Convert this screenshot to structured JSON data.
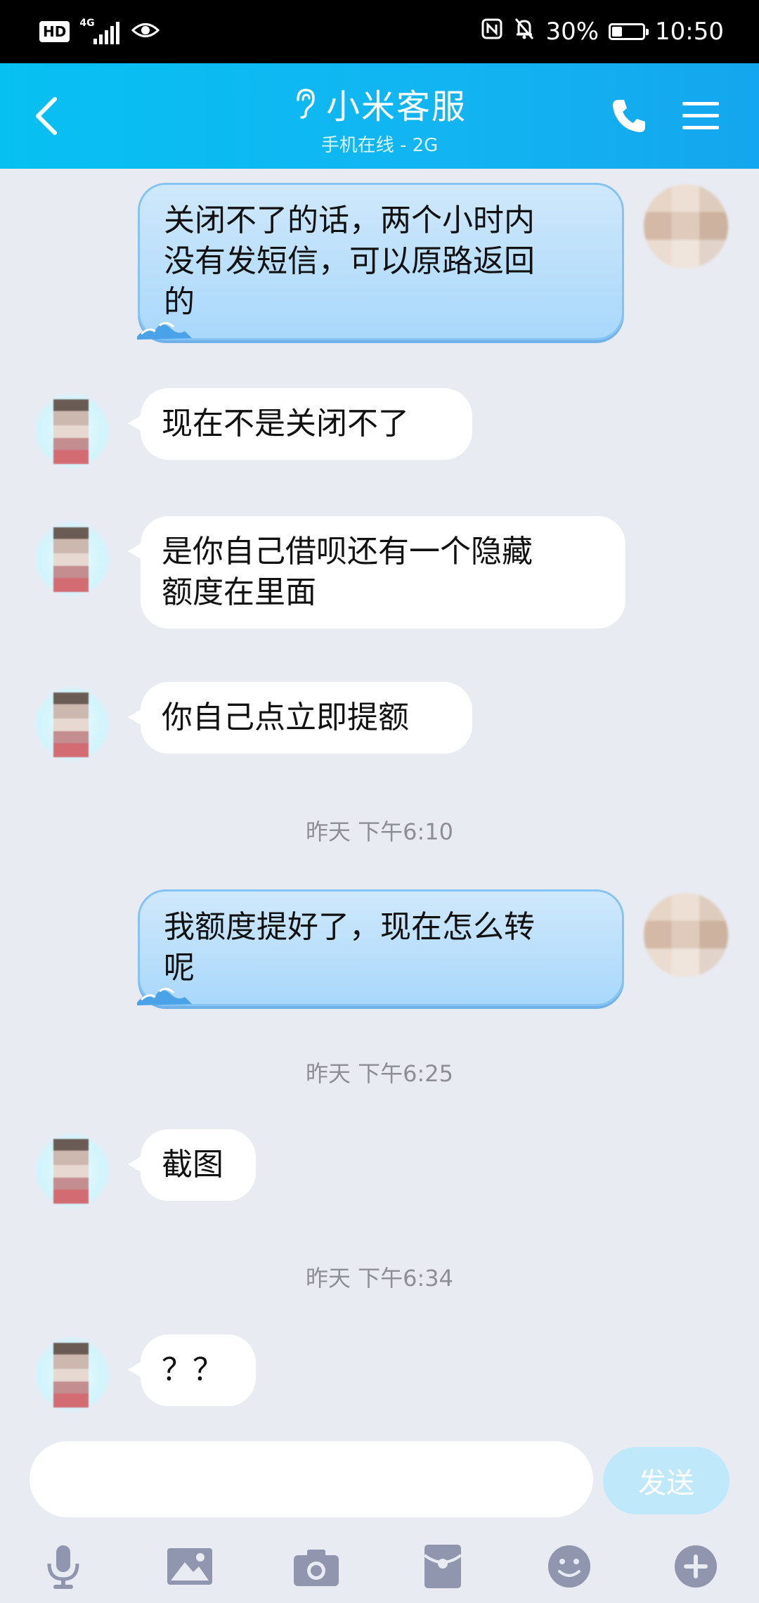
{
  "status_bar": {
    "hd": "HD",
    "network": "4G",
    "battery": "30%",
    "battery_level": 0.3,
    "time": "10:50",
    "icons": [
      "eye-icon",
      "nfc-icon",
      "mute-bell-icon"
    ]
  },
  "header": {
    "title": "小米客服",
    "subtitle": "手机在线 - 2G",
    "icons": [
      "back-icon",
      "ear-icon",
      "phone-icon",
      "menu-icon"
    ]
  },
  "messages": [
    {
      "from": "self",
      "lines": [
        "关闭不了的话，两个小时内",
        "没有发短信，可以原路返回",
        "的"
      ]
    },
    {
      "from": "agent",
      "lines": [
        "现在不是关闭不了"
      ]
    },
    {
      "from": "agent",
      "lines": [
        "是你自己借呗还有一个隐藏",
        "额度在里面"
      ]
    },
    {
      "from": "agent",
      "lines": [
        "你自己点立即提额"
      ]
    },
    {
      "timestamp": "昨天  下午6:10"
    },
    {
      "from": "self",
      "lines": [
        "我额度提好了，现在怎么转",
        "呢"
      ]
    },
    {
      "timestamp": "昨天  下午6:25"
    },
    {
      "from": "agent",
      "lines": [
        "截图"
      ]
    },
    {
      "timestamp": "昨天  下午6:34"
    },
    {
      "from": "agent",
      "lines": [
        "？？"
      ]
    }
  ],
  "input": {
    "value": "",
    "send_label": "发送"
  },
  "toolbar": {
    "icons": [
      "microphone-icon",
      "image-icon",
      "camera-icon",
      "red-packet-icon",
      "emoji-icon",
      "plus-icon"
    ]
  },
  "colors": {
    "header": "#12b4f1",
    "background": "#e9ebf3",
    "self_bubble": "#a9d8fb",
    "agent_bubble": "#ffffff",
    "send_button": "#bfe9fb"
  }
}
